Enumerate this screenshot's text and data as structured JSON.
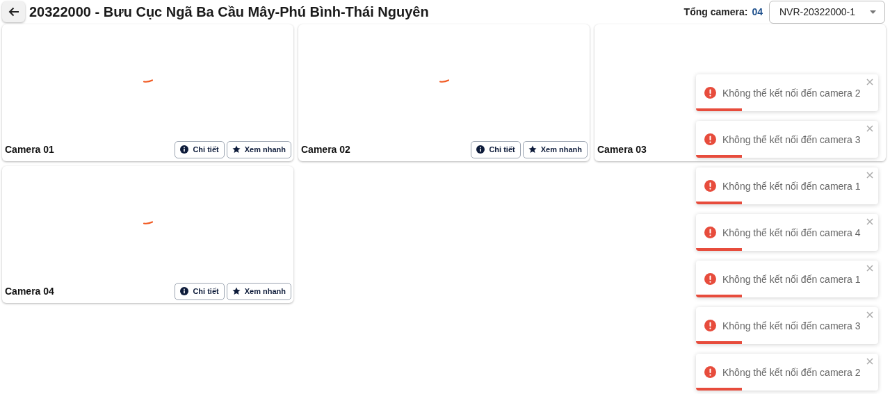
{
  "header": {
    "title": "20322000 - Bưu Cục Ngã Ba Cầu Mây-Phú Bình-Thái Nguyên",
    "total_label": "Tổng camera:",
    "total_value": "04",
    "nvr_select": {
      "value": "NVR-20322000-1"
    }
  },
  "cameras": [
    {
      "name": "Camera 01",
      "buttons": [
        {
          "kind": "info",
          "label": "Chi tiết"
        },
        {
          "kind": "star",
          "label": "Xem nhanh"
        }
      ]
    },
    {
      "name": "Camera 02",
      "buttons": [
        {
          "kind": "info",
          "label": "Chi tiết"
        },
        {
          "kind": "star",
          "label": "Xem nhanh"
        }
      ]
    },
    {
      "name": "Camera 03"
    },
    {
      "name": "Camera 04",
      "buttons": [
        {
          "kind": "info",
          "label": "Chi tiết"
        },
        {
          "kind": "star",
          "label": "Xem nhanh"
        }
      ]
    }
  ],
  "toasts": [
    {
      "kind": "error",
      "message": "Không thể kết nối đến camera 2",
      "level": 0.25
    },
    {
      "kind": "error",
      "message": "Không thể kết nối đến camera 3",
      "level": 0.25
    },
    {
      "kind": "error",
      "message": "Không thể kết nối đến camera 1",
      "level": 0.25
    },
    {
      "kind": "error",
      "message": "Không thể kết nối đến camera 4",
      "level": 0.25
    },
    {
      "kind": "error",
      "message": "Không thể kết nối đến camera 1",
      "level": 0.25
    },
    {
      "kind": "error",
      "message": "Không thể kết nối đến camera 3",
      "level": 0.25
    },
    {
      "kind": "error",
      "message": "Không thể kết nối đến camera 2",
      "level": 0.25
    }
  ]
}
